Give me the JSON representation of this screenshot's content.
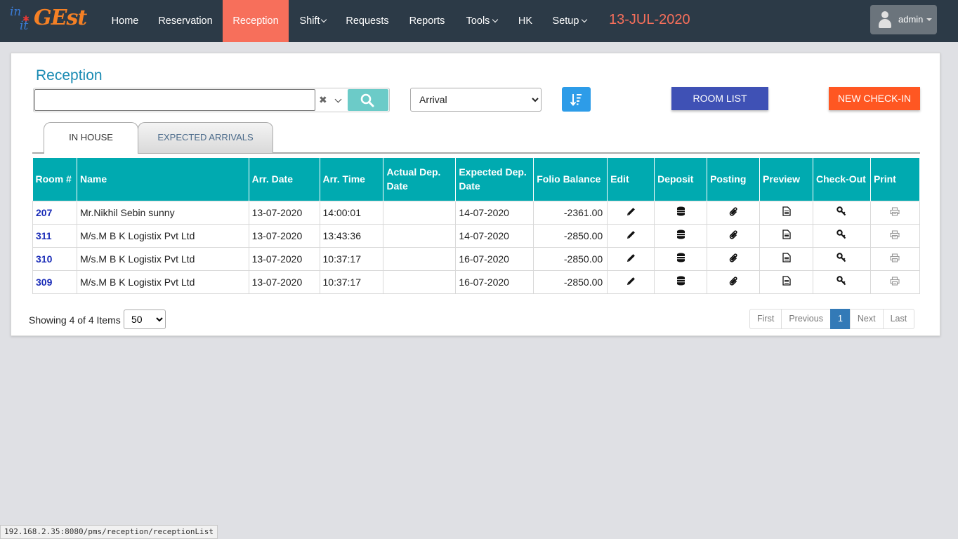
{
  "nav": {
    "logo": {
      "part1": "in",
      "part2": "it",
      "part3": "GEst"
    },
    "items": [
      {
        "label": "Home",
        "dropdown": false,
        "active": false
      },
      {
        "label": "Reservation",
        "dropdown": false,
        "active": false
      },
      {
        "label": "Reception",
        "dropdown": false,
        "active": true
      },
      {
        "label": "Shift",
        "dropdown": true,
        "active": false
      },
      {
        "label": "Requests",
        "dropdown": false,
        "active": false
      },
      {
        "label": "Reports",
        "dropdown": false,
        "active": false
      },
      {
        "label": "Tools",
        "dropdown": true,
        "active": false
      },
      {
        "label": "HK",
        "dropdown": false,
        "active": false
      },
      {
        "label": "Setup",
        "dropdown": true,
        "active": false
      }
    ],
    "date": "13-JUL-2020",
    "user": "admin"
  },
  "page": {
    "title": "Reception",
    "search": {
      "value": "",
      "placeholder": ""
    },
    "filter": {
      "selected": "Arrival",
      "options": [
        "Arrival"
      ]
    },
    "buttons": {
      "room_list": "ROOM LIST",
      "new_checkin": "NEW CHECK-IN"
    },
    "tabs": [
      {
        "label": "IN HOUSE",
        "active": true
      },
      {
        "label": "EXPECTED ARRIVALS",
        "active": false
      }
    ]
  },
  "table": {
    "headers": {
      "room": "Room #",
      "name": "Name",
      "arr_date": "Arr. Date",
      "arr_time": "Arr. Time",
      "actual_dep": "Actual Dep. Date",
      "expected_dep": "Expected Dep. Date",
      "folio": "Folio Balance",
      "edit": "Edit",
      "deposit": "Deposit",
      "posting": "Posting",
      "preview": "Preview",
      "checkout": "Check-Out",
      "print": "Print"
    },
    "rows": [
      {
        "room": "207",
        "name": "Mr.Nikhil Sebin sunny",
        "arr_date": "13-07-2020",
        "arr_time": "14:00:01",
        "actual_dep": "",
        "expected_dep": "14-07-2020",
        "folio": "-2361.00"
      },
      {
        "room": "311",
        "name": "M/s.M B K Logistix Pvt Ltd",
        "arr_date": "13-07-2020",
        "arr_time": "13:43:36",
        "actual_dep": "",
        "expected_dep": "14-07-2020",
        "folio": "-2850.00"
      },
      {
        "room": "310",
        "name": "M/s.M B K Logistix Pvt Ltd",
        "arr_date": "13-07-2020",
        "arr_time": "10:37:17",
        "actual_dep": "",
        "expected_dep": "16-07-2020",
        "folio": "-2850.00"
      },
      {
        "room": "309",
        "name": "M/s.M B K Logistix Pvt Ltd",
        "arr_date": "13-07-2020",
        "arr_time": "10:37:17",
        "actual_dep": "",
        "expected_dep": "16-07-2020",
        "folio": "-2850.00"
      }
    ],
    "row_icons": {
      "edit": "pencil-icon",
      "deposit": "database-icon",
      "posting": "paperclip-icon",
      "preview": "document-icon",
      "checkout": "key-icon",
      "print": "printer-icon"
    }
  },
  "footer": {
    "showing": "Showing 4 of 4 Items",
    "page_size": "50",
    "pager": [
      "First",
      "Previous",
      "1",
      "Next",
      "Last"
    ],
    "current_page": "1"
  },
  "statusbar": "192.168.2.35:8080/pms/reception/receptionList",
  "colors": {
    "navbar": "#2c3a47",
    "nav_active": "#f76f5b",
    "header_teal": "#00aab0",
    "room_list_button": "#3f51b5",
    "checkin_button": "#ff5722",
    "sort_button": "#2d9ce8",
    "search_button": "#6ccbc8",
    "title": "#1a8bb3",
    "room_link": "#1b2db8"
  }
}
